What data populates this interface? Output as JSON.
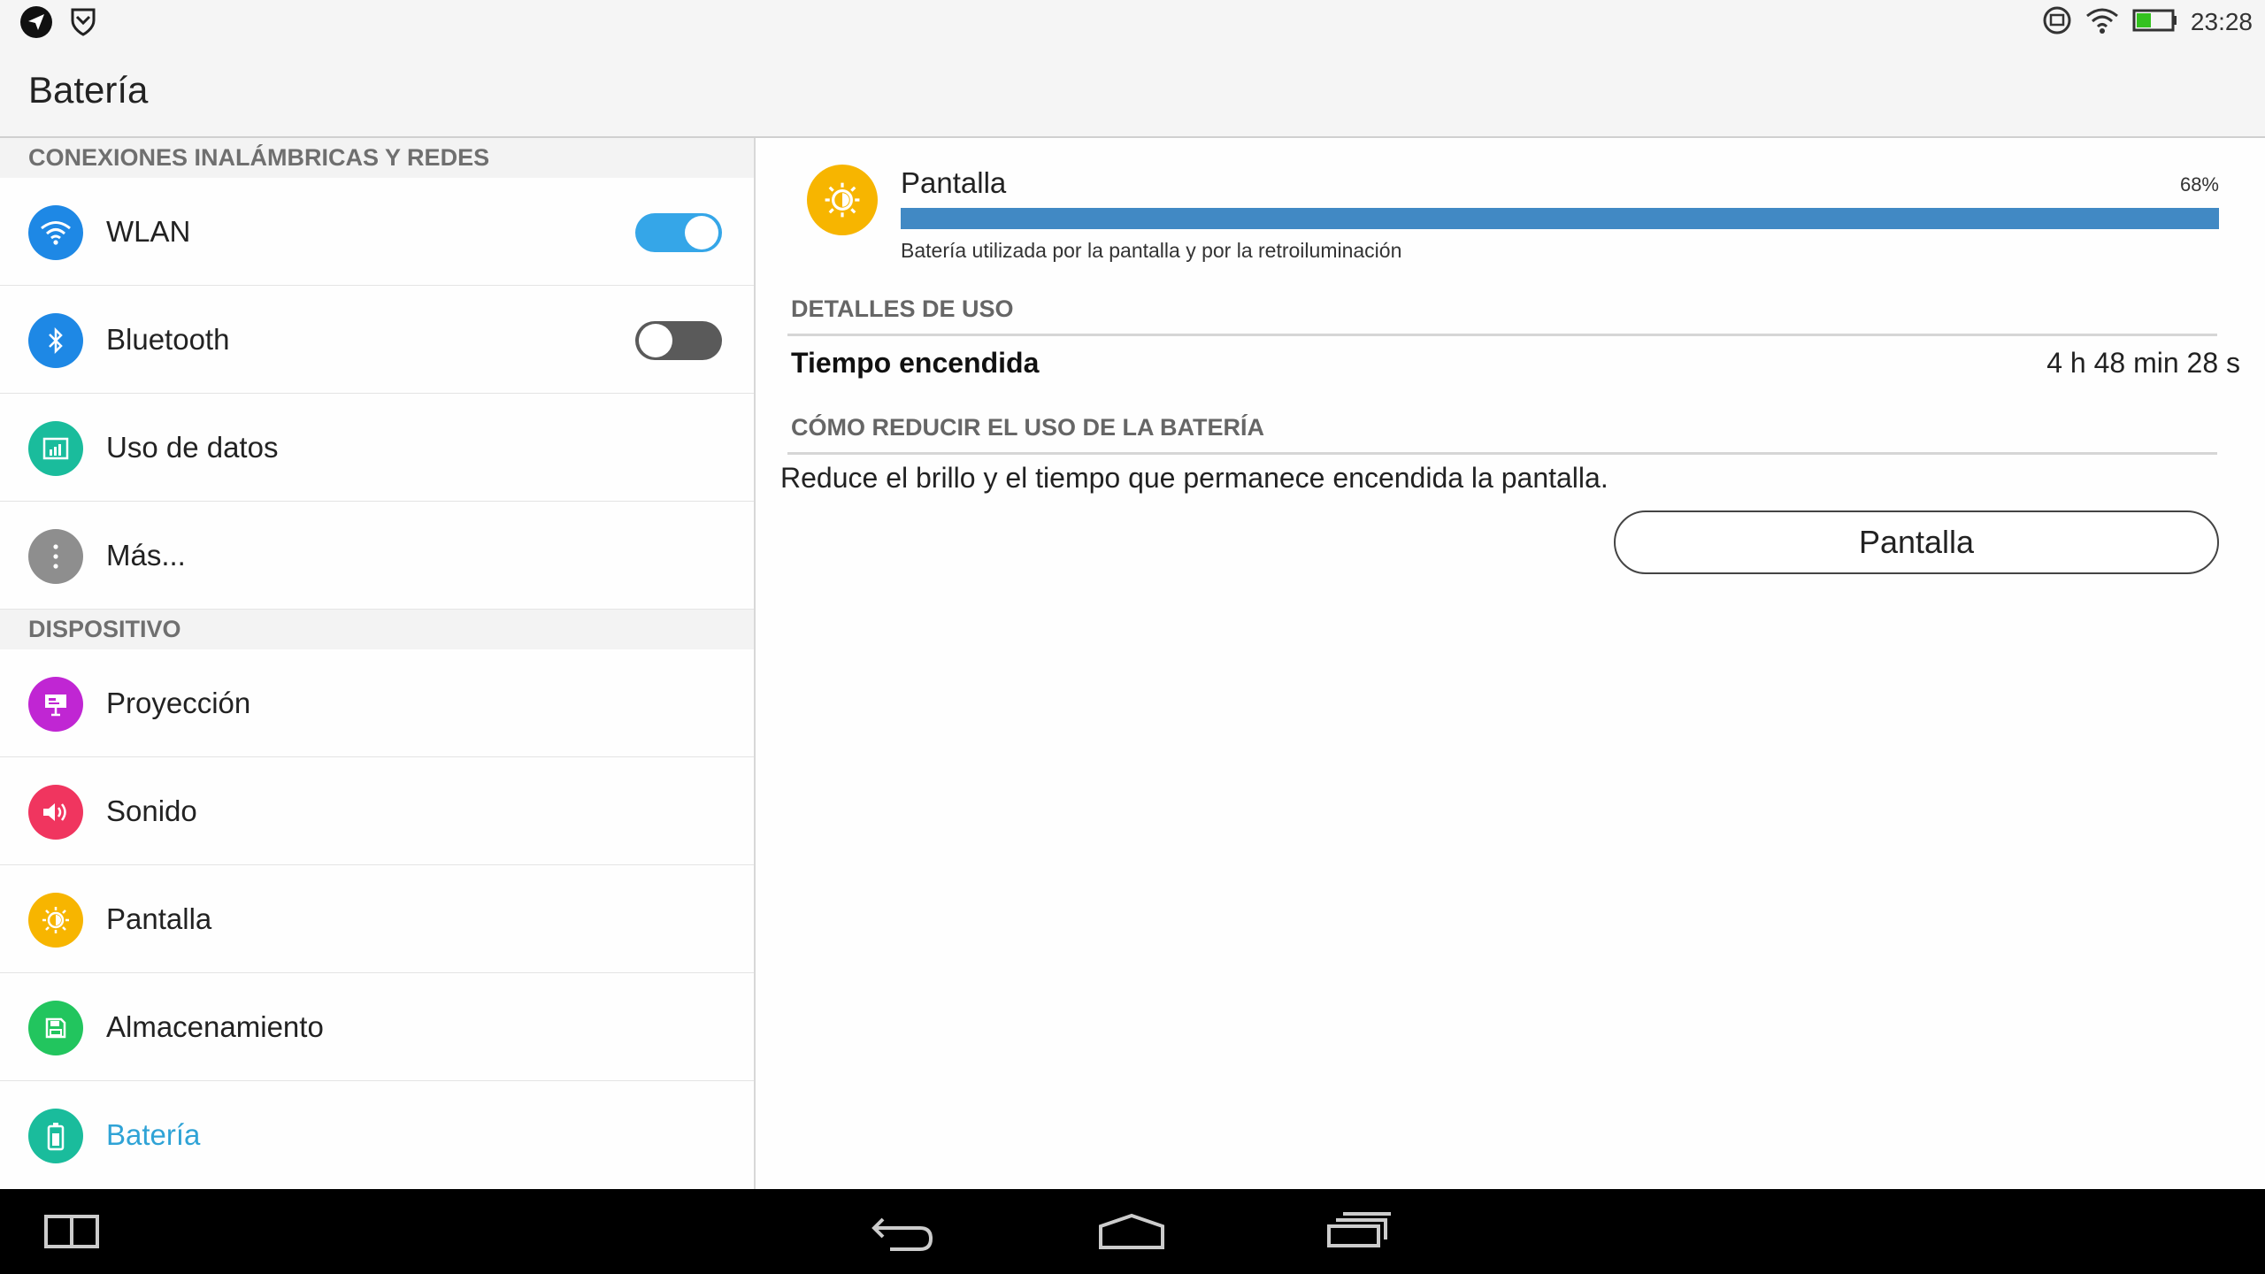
{
  "status_bar": {
    "time": "23:28"
  },
  "header": {
    "title": "Batería"
  },
  "sidebar": {
    "sections": [
      {
        "title": "CONEXIONES INALÁMBRICAS Y REDES",
        "items": [
          {
            "label": "WLAN",
            "icon": "wifi-icon",
            "color": "#1e88e5",
            "toggle": "on"
          },
          {
            "label": "Bluetooth",
            "icon": "bluetooth-icon",
            "color": "#1e88e5",
            "toggle": "off"
          },
          {
            "label": "Uso de datos",
            "icon": "data-usage-icon",
            "color": "#1abc9c"
          },
          {
            "label": "Más...",
            "icon": "more-icon",
            "color": "#8e8e8e"
          }
        ]
      },
      {
        "title": "DISPOSITIVO",
        "items": [
          {
            "label": "Proyección",
            "icon": "projection-icon",
            "color": "#c026d3"
          },
          {
            "label": "Sonido",
            "icon": "sound-icon",
            "color": "#f0355f"
          },
          {
            "label": "Pantalla",
            "icon": "brightness-icon",
            "color": "#f7b500"
          },
          {
            "label": "Almacenamiento",
            "icon": "storage-icon",
            "color": "#22c55e"
          },
          {
            "label": "Batería",
            "icon": "battery-icon",
            "color": "#1abc9c",
            "active": true
          }
        ]
      }
    ]
  },
  "detail": {
    "app": {
      "name": "Pantalla",
      "percent": "68%",
      "fill_fraction": 1.0,
      "description": "Batería utilizada por la pantalla y por la retroiluminación"
    },
    "usage_section": "DETALLES DE USO",
    "usage": {
      "label": "Tiempo encendida",
      "value": "4 h 48 min 28 s"
    },
    "reduce_section": "CÓMO REDUCIR EL USO DE LA BATERÍA",
    "tip": "Reduce el brillo y el tiempo que permanece encendida la pantalla.",
    "button_label": "Pantalla"
  },
  "colors": {
    "accent": "#2fa3d6",
    "bar": "#4189c4",
    "toggle_on": "#35a6e8"
  }
}
